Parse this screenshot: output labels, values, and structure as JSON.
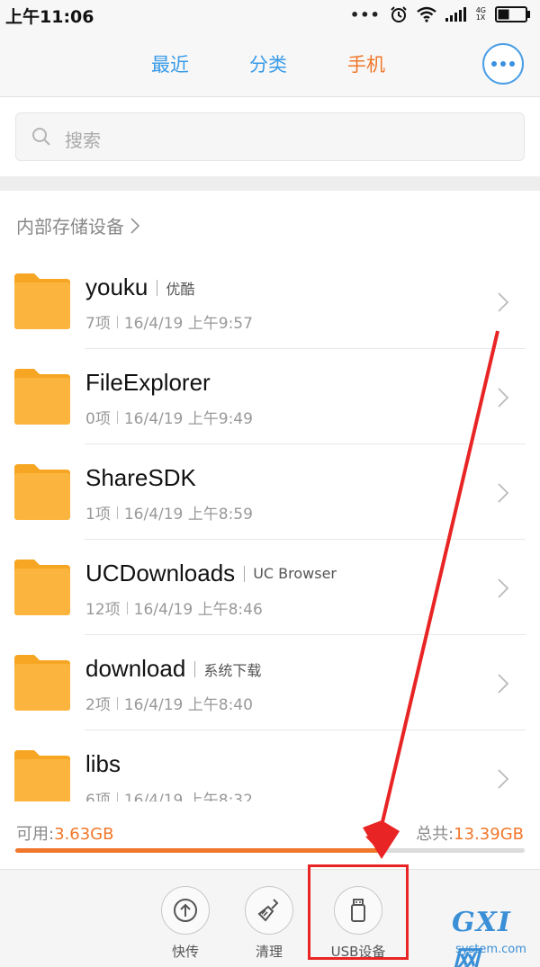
{
  "status_bar": {
    "time": "上午11:06",
    "dots": "•••",
    "network_label": "4G\n1X"
  },
  "header": {
    "tabs": [
      {
        "label": "最近",
        "color": "#3a9be8"
      },
      {
        "label": "分类",
        "color": "#3a9be8"
      },
      {
        "label": "手机",
        "color": "#f0772b",
        "active": true
      }
    ],
    "more_icon": "more-dots-icon"
  },
  "search": {
    "placeholder": "搜索"
  },
  "breadcrumb": {
    "label": "内部存储设备"
  },
  "files": [
    {
      "name": "youku",
      "alias": "优酷",
      "count": "7项",
      "date": "16/4/19 上午9:57"
    },
    {
      "name": "FileExplorer",
      "alias": "",
      "count": "0项",
      "date": "16/4/19 上午9:49"
    },
    {
      "name": "ShareSDK",
      "alias": "",
      "count": "1项",
      "date": "16/4/19 上午8:59"
    },
    {
      "name": "UCDownloads",
      "alias": "UC Browser",
      "count": "12项",
      "date": "16/4/19 上午8:46"
    },
    {
      "name": "download",
      "alias": "系统下载",
      "count": "2项",
      "date": "16/4/19 上午8:40"
    },
    {
      "name": "libs",
      "alias": "",
      "count": "6项",
      "date": "16/4/19 上午8:32"
    }
  ],
  "storage": {
    "available_label": "可用:",
    "available_value": "3.63GB",
    "total_label": "总共:",
    "total_value": "13.39GB",
    "used_fraction": 0.72
  },
  "toolbar": {
    "tools": [
      {
        "label": "快传",
        "icon": "quick-transfer-icon"
      },
      {
        "label": "清理",
        "icon": "broom-icon"
      },
      {
        "label": "USB设备",
        "icon": "usb-drive-icon"
      }
    ]
  },
  "colors": {
    "accent_blue": "#3a9be8",
    "accent_orange": "#f0772b",
    "folder": "#fbb53e",
    "annotation_red": "#e82424"
  },
  "watermark": {
    "mark": "GXI网",
    "site": "system.com"
  }
}
